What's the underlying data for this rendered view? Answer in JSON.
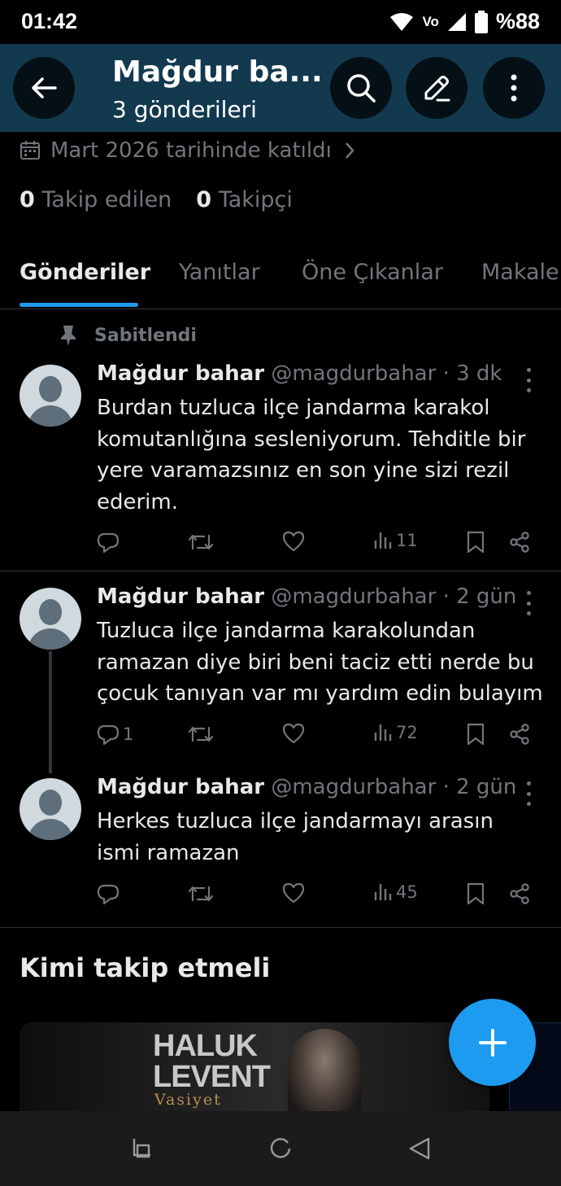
{
  "status_bar": {
    "time": "01:42",
    "volte": "Vo",
    "battery": "%88",
    "icons": [
      "wifi-icon",
      "volte-icon",
      "signal-icon",
      "battery-icon"
    ]
  },
  "header": {
    "title": "Mağdur ba...",
    "subtitle": "3 gönderileri",
    "icons": [
      "back-arrow-icon",
      "search-icon",
      "edit-icon",
      "more-vertical-icon"
    ]
  },
  "profile": {
    "joined": "Mart 2026 tarihinde katıldı",
    "following_count": "0",
    "following_label": "Takip edilen",
    "followers_count": "0",
    "followers_label": "Takipçi"
  },
  "tabs": [
    {
      "label": "Gönderiler",
      "active": true
    },
    {
      "label": "Yanıtlar",
      "active": false
    },
    {
      "label": "Öne Çıkanlar",
      "active": false
    },
    {
      "label": "Makale",
      "active": false
    }
  ],
  "pinned_label": "Sabitlendi",
  "posts": [
    {
      "name": "Mağdur bahar",
      "handle": "@magdurbahar · 3 dk",
      "lines": [
        "Burdan tuzluca ilçe jandarma karakol",
        "komutanlığına sesleniyorum. Tehditle bir",
        "yere varamazsınız en son yine sizi rezil",
        "ederim."
      ],
      "replies": "",
      "views": "11"
    },
    {
      "name": "Mağdur bahar",
      "handle": "@magdurbahar · 2 gün",
      "lines": [
        "Tuzluca ilçe jandarma karakolundan",
        "ramazan diye biri beni taciz etti nerde bu",
        "çocuk tanıyan var mı yardım edin bulayım"
      ],
      "replies": "1",
      "views": "72"
    },
    {
      "name": "Mağdur bahar",
      "handle": "@magdurbahar · 2 gün",
      "lines": [
        "Herkes tuzluca ilçe jandarmayı arasın",
        "ismi ramazan"
      ],
      "replies": "",
      "views": "45"
    }
  ],
  "who_to_follow": {
    "title": "Kimi takip etmeli",
    "card_line1": "HALUK",
    "card_line2": "LEVENT",
    "card_subtitle": "Vasiyet"
  },
  "colors": {
    "header_bg": "#13394f",
    "accent": "#1d9bf0",
    "muted": "#71767b",
    "text": "#e7e9ea"
  }
}
